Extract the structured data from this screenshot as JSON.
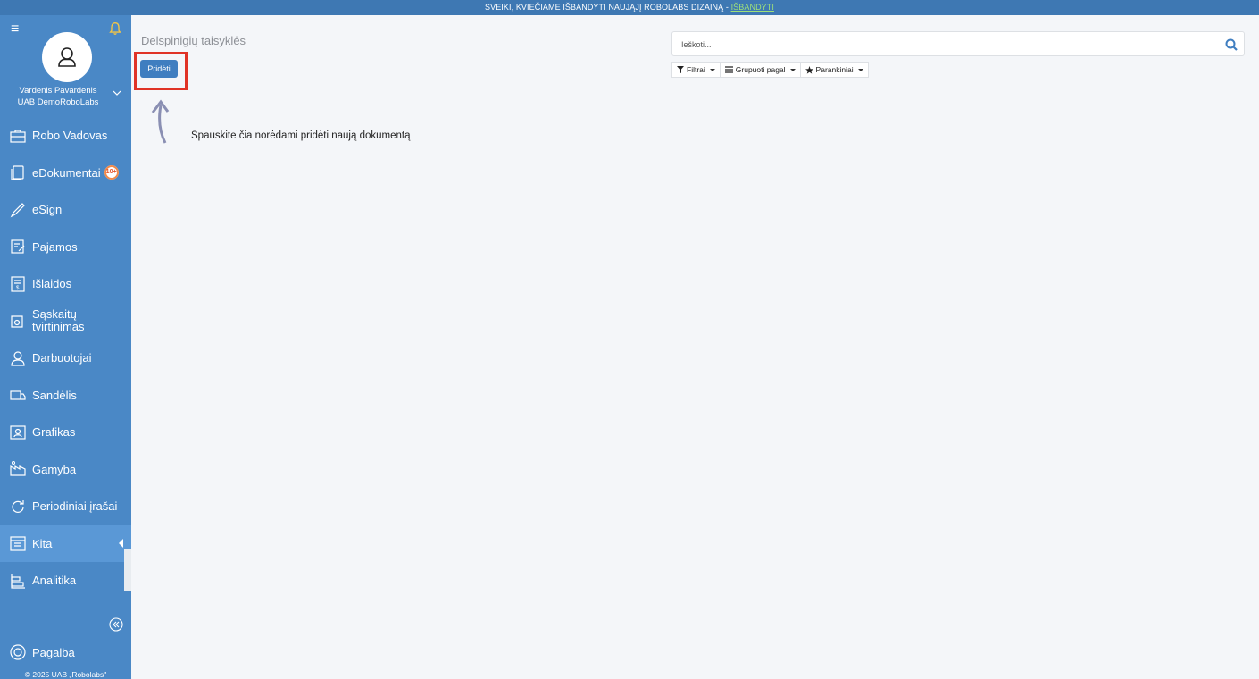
{
  "banner": {
    "text": "SVEIKI, KVIEČIAME IŠBANDYTI NAUJĄJĮ ROBOLABS DIZAINĄ - ",
    "link": "IŠBANDYTI"
  },
  "user": {
    "name": "Vardenis Pavardenis",
    "company": "UAB DemoRoboLabs"
  },
  "sidebar": {
    "items": [
      {
        "label": "Robo Vadovas",
        "icon": "briefcase-icon"
      },
      {
        "label": "eDokumentai",
        "icon": "documents-icon",
        "badge": "10+"
      },
      {
        "label": "eSign",
        "icon": "pen-icon"
      },
      {
        "label": "Pajamos",
        "icon": "income-icon"
      },
      {
        "label": "Išlaidos",
        "icon": "expenses-icon"
      },
      {
        "label": "Sąskaitų tvirtinimas",
        "icon": "invoice-approval-icon"
      },
      {
        "label": "Darbuotojai",
        "icon": "employees-icon"
      },
      {
        "label": "Sandėlis",
        "icon": "truck-icon"
      },
      {
        "label": "Grafikas",
        "icon": "schedule-icon"
      },
      {
        "label": "Gamyba",
        "icon": "factory-icon"
      },
      {
        "label": "Periodiniai įrašai",
        "icon": "refresh-icon"
      },
      {
        "label": "Kita",
        "icon": "other-icon",
        "active": true
      },
      {
        "label": "Analitika",
        "icon": "analytics-icon"
      }
    ],
    "help": "Pagalba",
    "copyright": "© 2025 UAB „Robolabs\""
  },
  "main": {
    "title": "Delspinigių taisyklės",
    "add_button": "Pridėti",
    "hint": "Spauskite čia norėdami pridėti naują dokumentą"
  },
  "search": {
    "placeholder": "Ieškoti..."
  },
  "filters": {
    "filter": "Filtrai",
    "group": "Grupuoti pagal",
    "favorites": "Parankiniai"
  },
  "colors": {
    "sidebar": "#4a88c6",
    "banner": "#3e78b3",
    "accent": "#3f7ec0",
    "highlight": "#e03326"
  }
}
